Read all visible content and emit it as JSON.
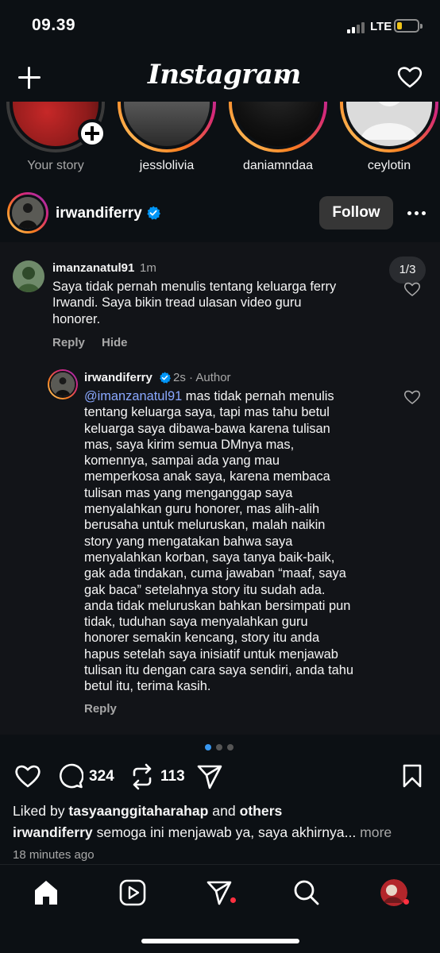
{
  "status_bar": {
    "time": "09.39",
    "network": "LTE",
    "battery_level": 0.2
  },
  "header": {
    "logo": "Instagram",
    "icons": [
      "plus-icon",
      "chevron-down-icon",
      "heart-icon"
    ]
  },
  "stories": [
    {
      "label": "Your story",
      "is_own": true
    },
    {
      "label": "jesslolivia"
    },
    {
      "label": "daniamndaa"
    },
    {
      "label": "ceylotin"
    }
  ],
  "post": {
    "username": "irwandiferry",
    "verified": true,
    "follow_label": "Follow",
    "page_indicator": "1/3",
    "comment": {
      "username": "imanzanatul91",
      "time": "1m",
      "lines": [
        "Saya tidak pernah menulis tentang keluarga ferry",
        "Irwandi. Saya bikin tread ulasan video guru",
        "honorer."
      ],
      "reply_label": "Reply",
      "hide_label": "Hide"
    },
    "reply": {
      "username": "irwandiferry",
      "time": "2s",
      "tag": "Author",
      "mention": "@imanzanatul91",
      "first_line_rest": " mas tidak pernah menulis",
      "lines": [
        "tentang keluarga saya, tapi mas tahu betul",
        "keluarga saya dibawa-bawa karena tulisan",
        "mas, saya kirim semua DMnya mas,",
        "komennya, sampai ada yang mau",
        "memperkosa anak saya, karena membaca",
        "tulisan mas yang menganggap saya",
        "menyalahkan guru honorer, mas alih-alih",
        "berusaha untuk meluruskan, malah naikin",
        "story yang mengatakan bahwa saya",
        "menyalahkan korban, saya tanya baik-baik,",
        "gak ada tindakan, cuma jawaban “maaf, saya",
        "gak baca” setelahnya story itu sudah ada.",
        "anda tidak meluruskan bahkan bersimpati pun",
        "tidak, tuduhan saya menyalahkan guru",
        "honorer semakin kencang, story itu anda",
        "hapus setelah saya inisiatif untuk menjawab",
        "tulisan itu dengan cara saya sendiri, anda tahu",
        "betul itu, terima kasih."
      ],
      "reply_label": "Reply"
    },
    "carousel": {
      "count": 3,
      "active": 0
    },
    "actions": {
      "comments": "324",
      "reposts": "113"
    },
    "liked_by_prefix": "Liked by ",
    "liked_by_user": "tasyaanggitaharahap",
    "liked_by_and": " and ",
    "liked_by_others": "others",
    "caption_user": "irwandiferry",
    "caption_text": " semoga ini menjawab ya, saya akhirnya...",
    "caption_more": " more",
    "posted_ago": "18 minutes ago"
  },
  "bottom_nav": [
    "home-icon",
    "reels-icon",
    "direct-icon",
    "search-icon",
    "profile-avatar"
  ],
  "colors": {
    "background": "#0c1014",
    "verified": "#0095f6",
    "mention": "#8aa8ff",
    "notification": "#ff3040"
  }
}
